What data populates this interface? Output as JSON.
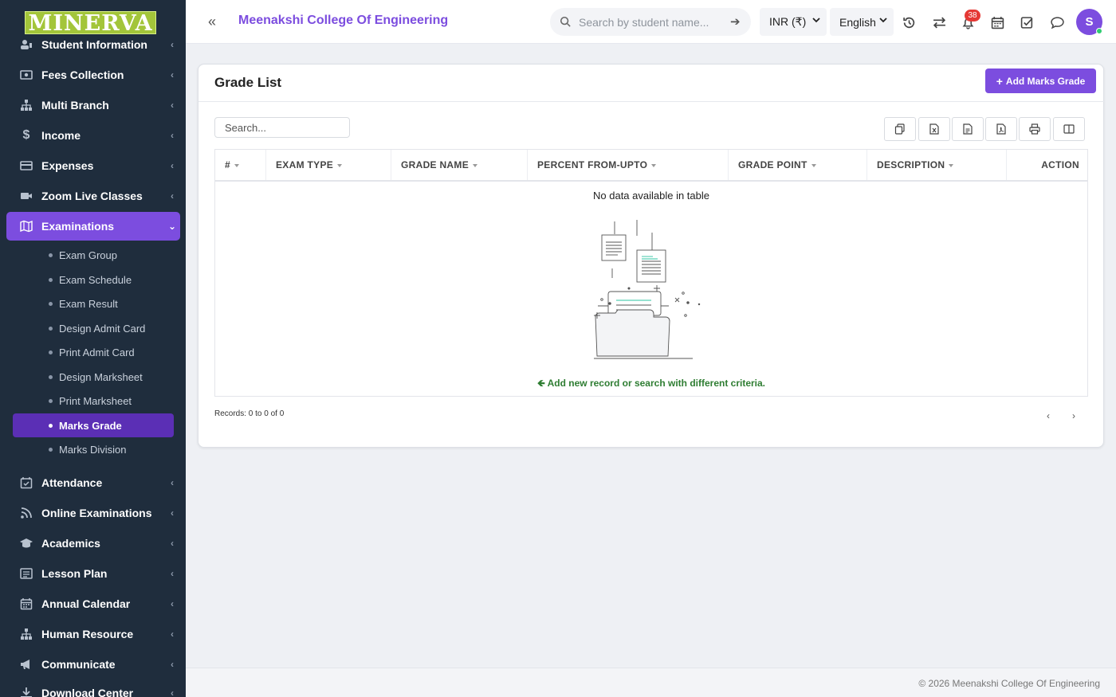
{
  "app": {
    "logo_text": "MINERVA",
    "college_name": "Meenakshi College Of Engineering"
  },
  "header": {
    "search_placeholder": "Search by student name...",
    "currency": "INR (₹)",
    "language": "English",
    "notification_count": "38",
    "avatar_initial": "S"
  },
  "sidebar": {
    "items": [
      {
        "label": "Student Information",
        "icon": "user-icon"
      },
      {
        "label": "Fees Collection",
        "icon": "money-icon"
      },
      {
        "label": "Multi Branch",
        "icon": "sitemap-icon"
      },
      {
        "label": "Income",
        "icon": "dollar-icon"
      },
      {
        "label": "Expenses",
        "icon": "credit-card-icon"
      },
      {
        "label": "Zoom Live Classes",
        "icon": "video-icon"
      },
      {
        "label": "Examinations",
        "icon": "map-icon"
      },
      {
        "label": "Attendance",
        "icon": "calendar-check-icon"
      },
      {
        "label": "Online Examinations",
        "icon": "rss-icon"
      },
      {
        "label": "Academics",
        "icon": "graduation-cap-icon"
      },
      {
        "label": "Lesson Plan",
        "icon": "list-icon"
      },
      {
        "label": "Annual Calendar",
        "icon": "calendar-icon"
      },
      {
        "label": "Human Resource",
        "icon": "sitemap-icon"
      },
      {
        "label": "Communicate",
        "icon": "bullhorn-icon"
      },
      {
        "label": "Download Center",
        "icon": "download-icon"
      }
    ],
    "submenu": [
      "Exam Group",
      "Exam Schedule",
      "Exam Result",
      "Design Admit Card",
      "Print Admit Card",
      "Design Marksheet",
      "Print Marksheet",
      "Marks Grade",
      "Marks Division"
    ]
  },
  "card": {
    "title": "Grade List",
    "add_button": "Add Marks Grade",
    "search_placeholder": "Search...",
    "columns": [
      "#",
      "EXAM TYPE",
      "GRADE NAME",
      "PERCENT FROM-UPTO",
      "GRADE POINT",
      "DESCRIPTION",
      "ACTION"
    ],
    "empty_text": "No data available in table",
    "hint": "Add new record or search with different criteria.",
    "records": "Records: 0 to 0 of 0"
  },
  "footer": {
    "text": "© 2026 Meenakshi College Of Engineering"
  },
  "colors": {
    "accent": "#7c4ddf",
    "sidebar_bg": "#1f2d3d",
    "hint_green": "#2e7d32",
    "badge_red": "#e53935"
  }
}
